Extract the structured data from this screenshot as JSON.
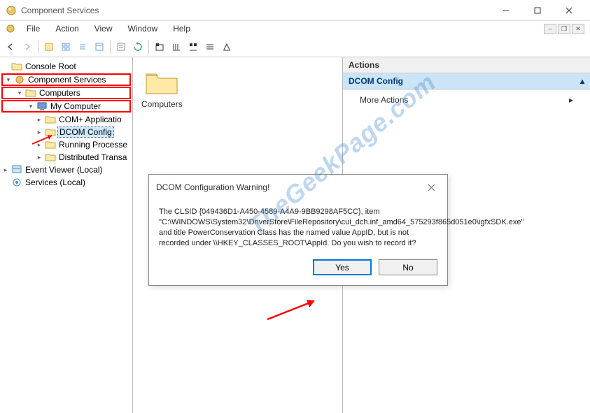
{
  "window": {
    "title": "Component Services"
  },
  "menu": {
    "file": "File",
    "action": "Action",
    "view": "View",
    "window": "Window",
    "help": "Help"
  },
  "tree": {
    "root": "Console Root",
    "comp_svc": "Component Services",
    "computers": "Computers",
    "my_computer": "My Computer",
    "com_apps": "COM+ Applicatio",
    "dcom": "DCOM Config",
    "running": "Running Processe",
    "distributed": "Distributed Transa",
    "event_viewer": "Event Viewer (Local)",
    "services": "Services (Local)"
  },
  "content": {
    "folder_name": "Computers"
  },
  "actions": {
    "header": "Actions",
    "section": "DCOM Config",
    "more": "More Actions"
  },
  "dialog": {
    "title": "DCOM Configuration Warning!",
    "body": "The CLSID {049436D1-A450-4589-A4A9-9BB9298AF5CC}, item \"C:\\WINDOWS\\System32\\DriverStore\\FileRepository\\cui_dch.inf_amd64_575293f865d051e0\\igfxSDK.exe\" and title PowerConservation Class has the named value AppID, but is not recorded under \\\\HKEY_CLASSES_ROOT\\AppId.  Do you wish to record it?",
    "yes": "Yes",
    "no": "No"
  },
  "watermark": "TheGeekPage.com"
}
